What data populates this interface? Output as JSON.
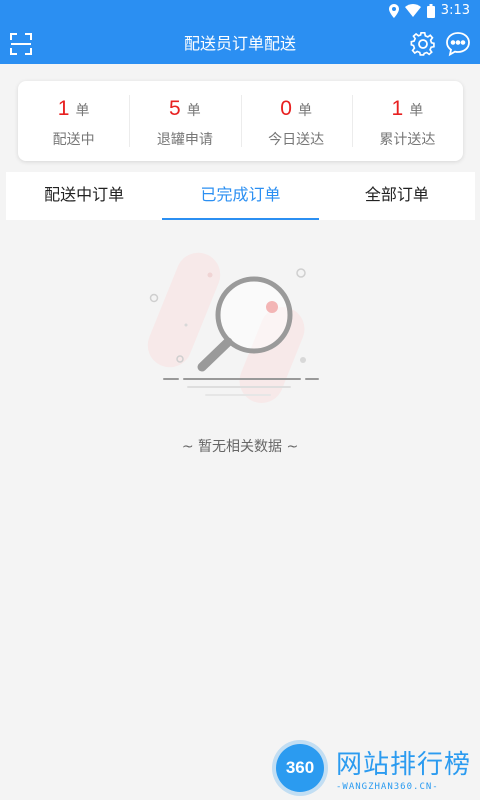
{
  "status_bar": {
    "time": "3:13"
  },
  "app_bar": {
    "title": "配送员订单配送",
    "scan_icon": "scan-icon",
    "settings_icon": "gear-icon",
    "message_icon": "chat-icon"
  },
  "stats": [
    {
      "value": "1",
      "unit": "单",
      "label": "配送中"
    },
    {
      "value": "5",
      "unit": "单",
      "label": "退罐申请"
    },
    {
      "value": "0",
      "unit": "单",
      "label": "今日送达"
    },
    {
      "value": "1",
      "unit": "单",
      "label": "累计送达"
    }
  ],
  "tabs": [
    {
      "label": "配送中订单",
      "active": false
    },
    {
      "label": "已完成订单",
      "active": true
    },
    {
      "label": "全部订单",
      "active": false
    }
  ],
  "empty_state": {
    "text": "~ 暂无相关数据 ~",
    "icon": "magnifier-icon"
  },
  "watermark": {
    "badge": "360",
    "title": "网站排行榜",
    "subtitle": "-WANGZHAN360.CN-"
  },
  "colors": {
    "primary": "#2b8ff2",
    "accent_red": "#e82020"
  }
}
